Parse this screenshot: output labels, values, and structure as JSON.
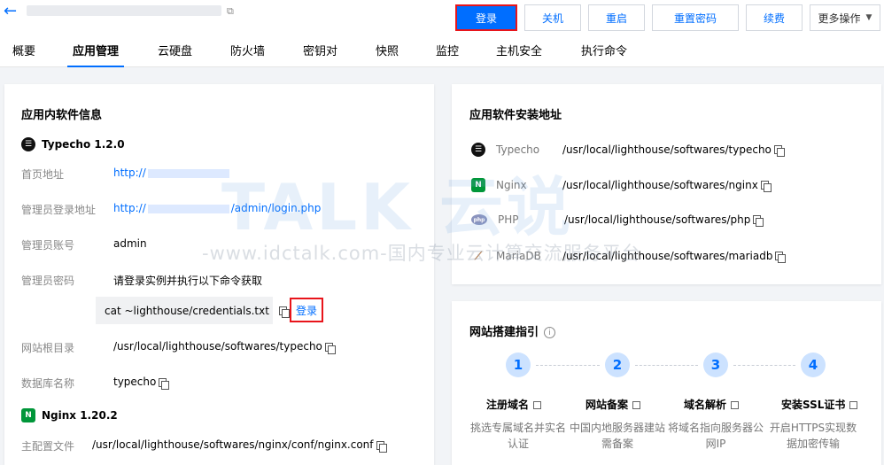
{
  "header": {
    "back_icon": "arrow-left-icon",
    "copy_icon": "copy-icon"
  },
  "actions": [
    {
      "label": "登录",
      "primary": true,
      "w": 70
    },
    {
      "label": "关机",
      "w": 64
    },
    {
      "label": "重启",
      "w": 64
    },
    {
      "label": "重置密码",
      "w": 98
    },
    {
      "label": "续费",
      "w": 64
    },
    {
      "label": "更多操作",
      "w": 80,
      "more": true
    }
  ],
  "tabs": [
    "概要",
    "应用管理",
    "云硬盘",
    "防火墙",
    "密钥对",
    "快照",
    "监控",
    "主机安全",
    "执行命令"
  ],
  "active_tab": "应用管理",
  "left": {
    "title": "应用内软件信息",
    "typecho": {
      "name": "Typecho 1.2.0",
      "homepage_label": "首页地址",
      "homepage_prefix": "http://",
      "admin_login_label": "管理员登录地址",
      "admin_login_prefix": "http://",
      "admin_login_suffix": "/admin/login.php",
      "admin_account_label": "管理员账号",
      "admin_account": "admin",
      "admin_password_label": "管理员密码",
      "admin_password_hint": "请登录实例并执行以下命令获取",
      "command": "cat ~lighthouse/credentials.txt",
      "login_link": "登录",
      "webroot_label": "网站根目录",
      "webroot": "/usr/local/lighthouse/softwares/typecho",
      "dbname_label": "数据库名称",
      "dbname": "typecho"
    },
    "nginx": {
      "name": "Nginx 1.20.2",
      "conf_label": "主配置文件",
      "conf": "/usr/local/lighthouse/softwares/nginx/conf/nginx.conf"
    }
  },
  "right_apps": {
    "title": "应用软件安装地址",
    "items": [
      {
        "icon": "typecho-icon",
        "name": "Typecho",
        "path": "/usr/local/lighthouse/softwares/typecho"
      },
      {
        "icon": "nginx-icon",
        "name": "Nginx",
        "path": "/usr/local/lighthouse/softwares/nginx"
      },
      {
        "icon": "php-icon",
        "name": "PHP",
        "path": "/usr/local/lighthouse/softwares/php"
      },
      {
        "icon": "mariadb-icon",
        "name": "MariaDB",
        "path": "/usr/local/lighthouse/softwares/mariadb"
      }
    ]
  },
  "guide": {
    "title": "网站搭建指引",
    "steps": [
      {
        "num": "1",
        "title": "注册域名",
        "desc": "挑选专属域名并实名认证"
      },
      {
        "num": "2",
        "title": "网站备案",
        "desc": "中国内地服务器建站需备案"
      },
      {
        "num": "3",
        "title": "域名解析",
        "desc": "将域名指向服务器公网IP"
      },
      {
        "num": "4",
        "title": "安装SSL证书",
        "desc": "开启HTTPS实现数据加密传输"
      }
    ]
  },
  "watermark": {
    "text": "-www.idctalk.com-国内专业云计算交流服务平台",
    "logo": "TALK 云说"
  },
  "colors": {
    "accent": "#006eff",
    "highlight_border": "#e8151b",
    "nginx_green": "#009639"
  }
}
